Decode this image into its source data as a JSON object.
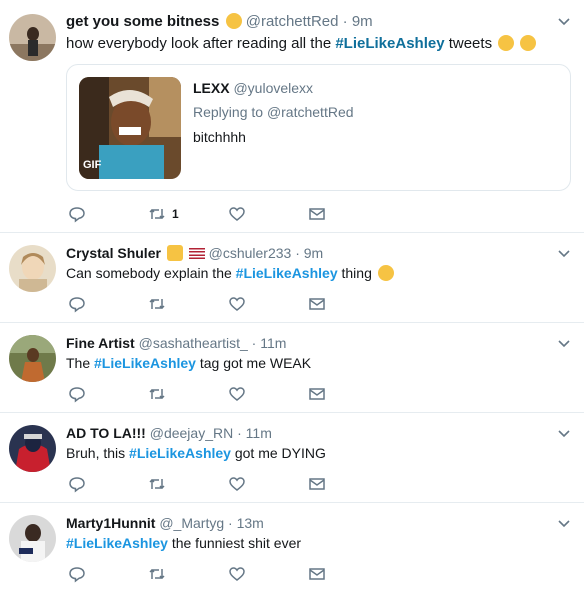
{
  "tweets": [
    {
      "name": "get you some bitness",
      "handle": "@ratchettRed",
      "time": "9m",
      "text_before": "how everybody look after reading all the ",
      "hashtag": "#LieLikeAshley",
      "text_after": " tweets",
      "retweets": "1",
      "quote": {
        "name": "LEXX",
        "handle": "@yulovelexx",
        "reply_prefix": "Replying to ",
        "reply_handle": "@ratchettRed",
        "text": "bitchhhh",
        "gif_label": "GIF"
      }
    },
    {
      "name": "Crystal Shuler",
      "handle": "@cshuler233",
      "time": "9m",
      "text_before": "Can somebody explain the ",
      "hashtag": "#LieLikeAshley",
      "text_after": " thing"
    },
    {
      "name": "Fine Artist",
      "handle": "@sashatheartist_",
      "time": "11m",
      "text_before": "The ",
      "hashtag": "#LieLikeAshley",
      "text_after": " tag got me WEAK"
    },
    {
      "name": "AD TO LA!!!",
      "handle": "@deejay_RN",
      "time": "11m",
      "text_before": "Bruh, this ",
      "hashtag": "#LieLikeAshley",
      "text_after": " got me DYING"
    },
    {
      "name": "Marty1Hunnit",
      "handle": "@_Martyg",
      "time": "13m",
      "text_before": "",
      "hashtag": "#LieLikeAshley",
      "text_after": " the funniest shit ever"
    }
  ],
  "separator": "·",
  "colors": {
    "hashtag": "#1b95e0",
    "muted": "#657786",
    "border": "#e6ecf0"
  }
}
